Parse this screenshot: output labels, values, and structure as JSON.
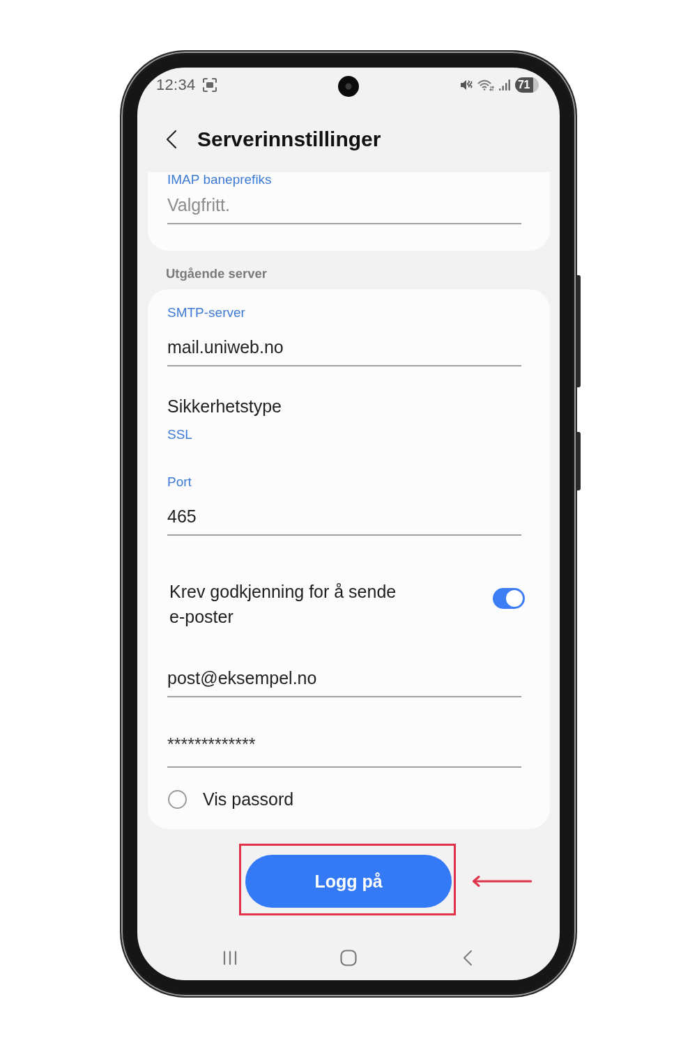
{
  "status_bar": {
    "time": "12:34",
    "battery": "71"
  },
  "header": {
    "title": "Serverinnstillinger"
  },
  "cards": [
    {
      "items": [
        {
          "kind": "field",
          "label": "IMAP baneprefiks",
          "placeholder": "Valgfritt."
        }
      ]
    },
    {
      "title": "Utgående server",
      "items": [
        {
          "kind": "field",
          "label": "SMTP-server",
          "value": "mail.uniweb.no"
        },
        {
          "kind": "select",
          "label": "Sikkerhetstype",
          "value": "SSL"
        },
        {
          "kind": "field",
          "label": "Port",
          "value": "465"
        },
        {
          "kind": "switch",
          "label": "Krev godkjenning for å sende e-poster",
          "on": true
        },
        {
          "kind": "field",
          "value": "post@eksempel.no"
        },
        {
          "kind": "password",
          "value": "*************"
        },
        {
          "kind": "check",
          "label": "Vis passord",
          "checked": false
        }
      ]
    }
  ],
  "button": {
    "label": "Logg på"
  },
  "annotation": {
    "frame": true,
    "arrow": true
  }
}
